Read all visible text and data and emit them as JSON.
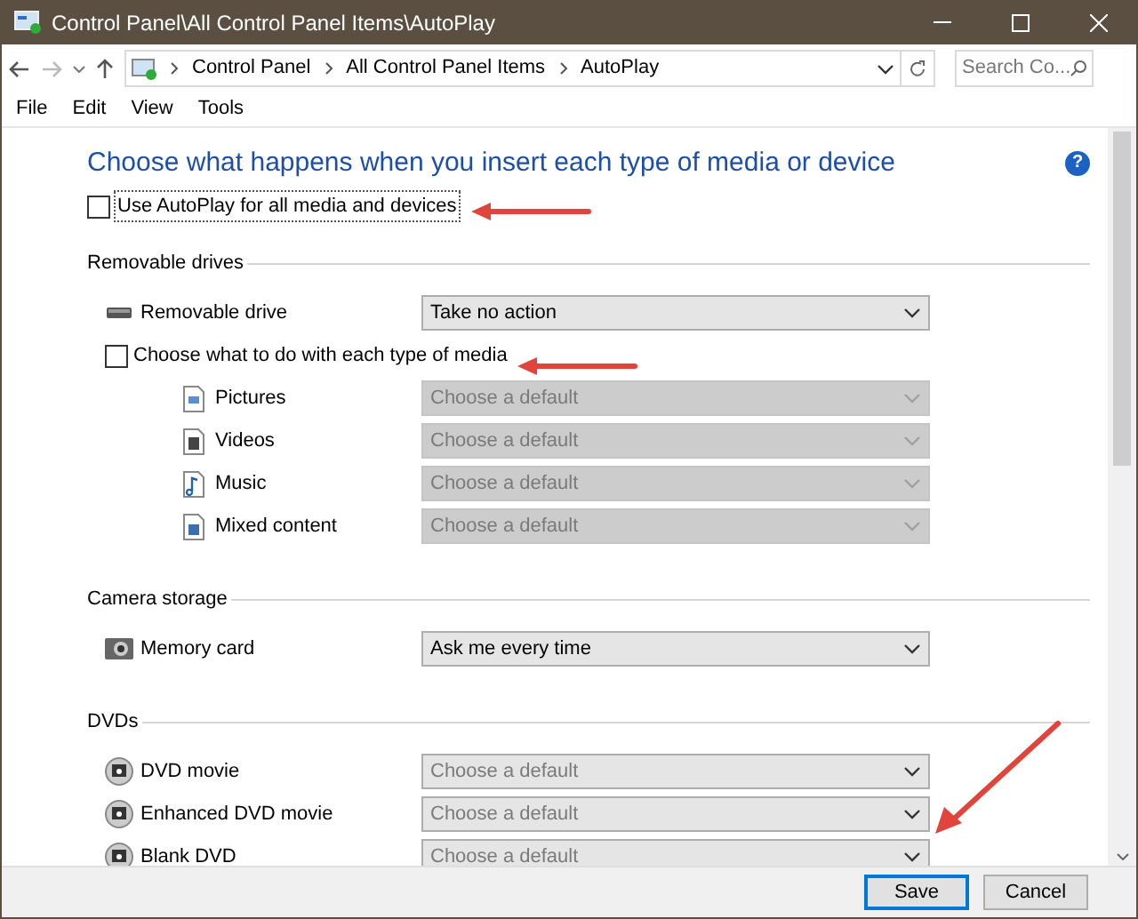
{
  "window": {
    "title": "Control Panel\\All Control Panel Items\\AutoPlay"
  },
  "address_bar": {
    "breadcrumb": [
      "Control Panel",
      "All Control Panel Items",
      "AutoPlay"
    ],
    "search": {
      "placeholder": "Search Co..."
    }
  },
  "menu": [
    "File",
    "Edit",
    "View",
    "Tools"
  ],
  "heading": "Choose what happens when you insert each type of media or device",
  "help_button": "?",
  "autoplay_checkbox": {
    "label": "Use AutoPlay for all media and devices",
    "checked": false,
    "focused": true
  },
  "sections": [
    {
      "title": "Removable drives",
      "rows": [
        {
          "kind": "device",
          "label": "Removable drive",
          "value": "Take no action",
          "disabled": false
        },
        {
          "kind": "checkbox",
          "label": "Choose what to do with each type of media",
          "checked": false
        },
        {
          "kind": "media",
          "label": "Pictures",
          "placeholder": "Choose a default",
          "disabled": true
        },
        {
          "kind": "media",
          "label": "Videos",
          "placeholder": "Choose a default",
          "disabled": true
        },
        {
          "kind": "media",
          "label": "Music",
          "placeholder": "Choose a default",
          "disabled": true
        },
        {
          "kind": "media",
          "label": "Mixed content",
          "placeholder": "Choose a default",
          "disabled": true
        }
      ]
    },
    {
      "title": "Camera storage",
      "rows": [
        {
          "kind": "device",
          "label": "Memory card",
          "value": "Ask me every time",
          "disabled": false
        }
      ]
    },
    {
      "title": "DVDs",
      "rows": [
        {
          "kind": "device",
          "label": "DVD movie",
          "placeholder": "Choose a default",
          "disabled": false
        },
        {
          "kind": "device",
          "label": "Enhanced DVD movie",
          "placeholder": "Choose a default",
          "disabled": false
        },
        {
          "kind": "device",
          "label": "Blank DVD",
          "placeholder": "Choose a default",
          "disabled": false
        }
      ]
    }
  ],
  "buttons": [
    {
      "label": "Save",
      "default": true
    },
    {
      "label": "Cancel",
      "default": false
    }
  ]
}
